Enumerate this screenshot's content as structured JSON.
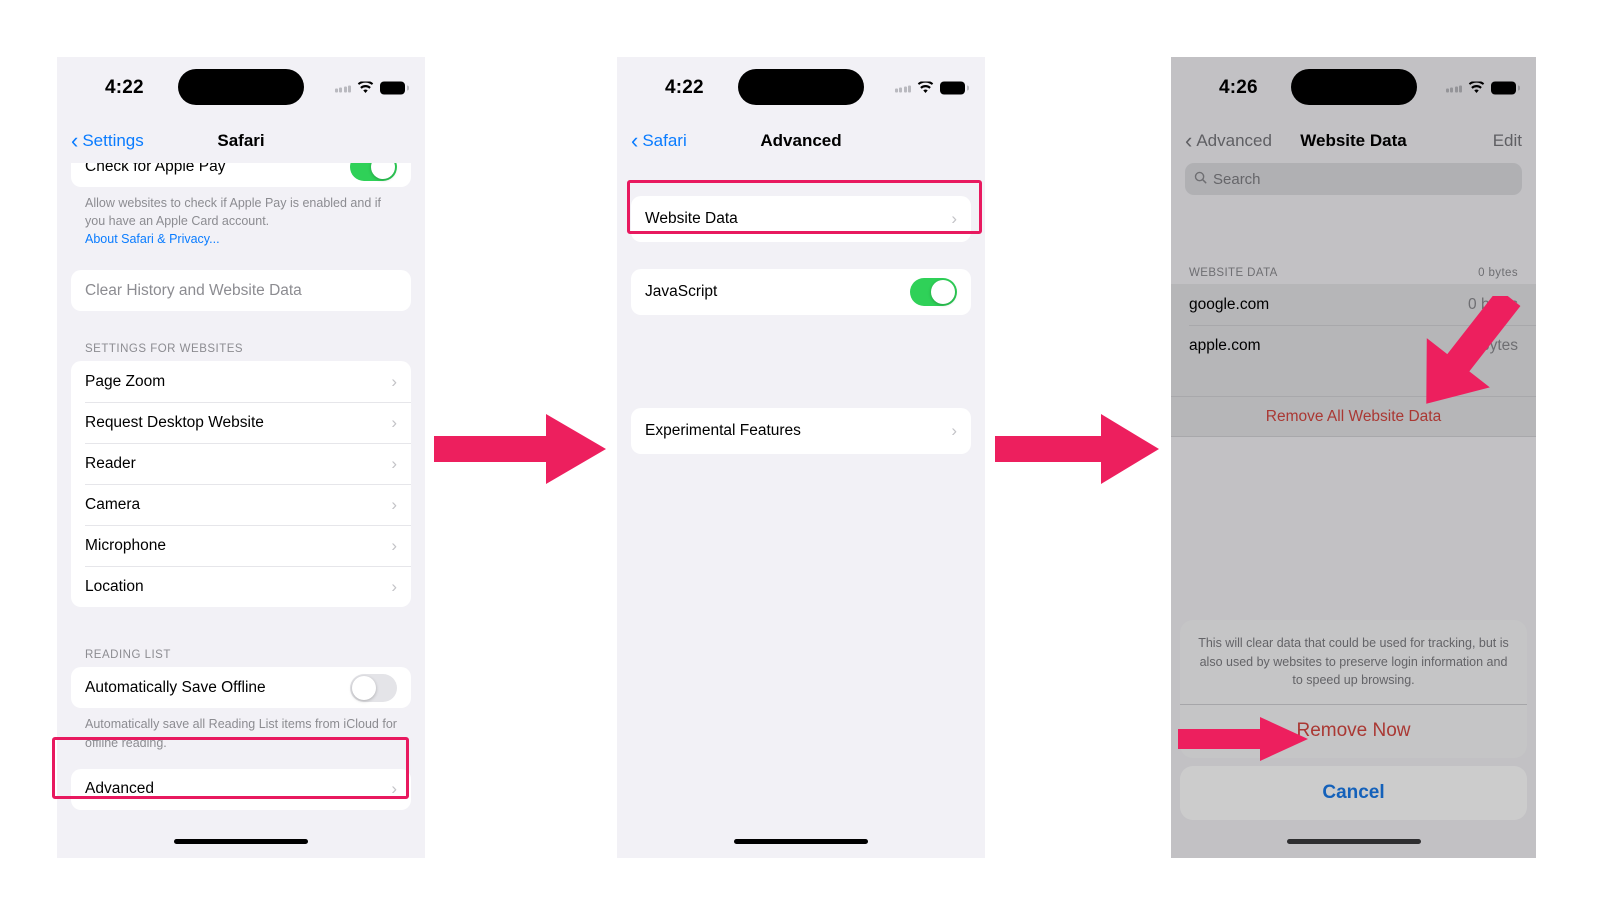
{
  "meta": {
    "accent_pink": "#e8195f",
    "ios_blue": "#0a7cff",
    "ios_red": "#e8413a",
    "toggle_green": "#2fd158"
  },
  "phone1": {
    "status": {
      "time": "4:22",
      "signal_icon": "cellular-bars-icon",
      "wifi_icon": "wifi-icon",
      "battery_icon": "battery-icon"
    },
    "nav": {
      "back_label": "Settings",
      "title": "Safari",
      "back_chevron": "‹"
    },
    "apple_pay_row": {
      "label": "Check for Apple Pay",
      "toggle_state": "on"
    },
    "apple_pay_footnote": {
      "text": "Allow websites to check if Apple Pay is enabled and if you have an Apple Card account.",
      "link": "About Safari & Privacy..."
    },
    "clear_history_row": {
      "label": "Clear History and Website Data"
    },
    "settings_for_websites": {
      "header": "SETTINGS FOR WEBSITES",
      "items": [
        {
          "label": "Page Zoom",
          "chevron": "›"
        },
        {
          "label": "Request Desktop Website",
          "chevron": "›"
        },
        {
          "label": "Reader",
          "chevron": "›"
        },
        {
          "label": "Camera",
          "chevron": "›"
        },
        {
          "label": "Microphone",
          "chevron": "›"
        },
        {
          "label": "Location",
          "chevron": "›"
        }
      ]
    },
    "reading_list": {
      "header": "READING LIST",
      "row": {
        "label": "Automatically Save Offline",
        "toggle_state": "off"
      },
      "footnote": "Automatically save all Reading List items from iCloud for offline reading."
    },
    "advanced_row": {
      "label": "Advanced",
      "chevron": "›",
      "highlighted": true
    }
  },
  "phone2": {
    "status": {
      "time": "4:22",
      "signal_icon": "cellular-bars-icon",
      "wifi_icon": "wifi-icon",
      "battery_icon": "battery-icon"
    },
    "nav": {
      "back_label": "Safari",
      "title": "Advanced",
      "back_chevron": "‹"
    },
    "website_data_row": {
      "label": "Website Data",
      "chevron": "›",
      "highlighted": true
    },
    "javascript_row": {
      "label": "JavaScript",
      "toggle_state": "on"
    },
    "experimental_row": {
      "label": "Experimental Features",
      "chevron": "›"
    }
  },
  "phone3": {
    "status": {
      "time": "4:26",
      "signal_icon": "cellular-bars-icon",
      "wifi_icon": "wifi-icon",
      "battery_icon": "battery-icon"
    },
    "nav": {
      "back_label": "Advanced",
      "title": "Website Data",
      "edit_label": "Edit",
      "back_chevron": "‹"
    },
    "search": {
      "placeholder": "Search",
      "icon": "search-icon"
    },
    "list_header": {
      "title": "WEBSITE DATA",
      "total": "0 bytes"
    },
    "sites": [
      {
        "domain": "google.com",
        "size": "0 bytes"
      },
      {
        "domain": "apple.com",
        "size": "0 bytes"
      }
    ],
    "remove_all_row": {
      "label": "Remove All Website Data"
    },
    "action_sheet": {
      "message": "This will clear data that could be used for tracking, but is also used by websites to preserve login information and to speed up browsing.",
      "confirm_label": "Remove Now",
      "cancel_label": "Cancel"
    }
  },
  "annotations": {
    "arrow1_name": "flow-arrow-1",
    "arrow2_name": "flow-arrow-2",
    "arrow3_name": "callout-arrow-remove-all",
    "arrow4_name": "callout-arrow-remove-now"
  }
}
